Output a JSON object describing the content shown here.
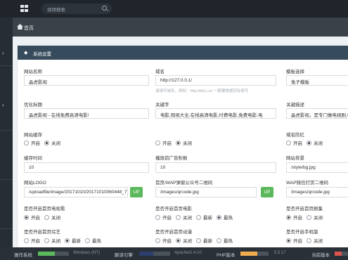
{
  "topbar": {
    "search_placeholder": "视频搜索"
  },
  "breadcrumb": {
    "home_label": "首页"
  },
  "panel": {
    "title": "系统设置"
  },
  "fields": {
    "site_name": {
      "label": "网站名称",
      "value": "晶虎影视"
    },
    "domain": {
      "label": "域名",
      "value": "http://127.0.0.1/",
      "hint": "请填写域名，例如：http://bb1.cn/ 一般要根据实际填写"
    },
    "template": {
      "label": "模板选择",
      "value": "免子模板"
    },
    "seo_title": {
      "label": "优化标题",
      "value": "晶虎影视 - 在线免费高清电影!"
    },
    "keywords": {
      "label": "关键字",
      "value": "电影,观视大全,在线高清电影,付费电影,免费电影,电"
    },
    "description": {
      "label": "关键描述",
      "value": "晶虎影视，是专门做电视剧,电"
    },
    "cache": {
      "label": "网站缓存",
      "options": [
        "开启",
        "关闭"
      ],
      "selected": 1
    },
    "domain_redirect": {
      "label": "域名防红",
      "options": [
        "开启",
        "关闭"
      ],
      "selected": 1
    },
    "cache_time": {
      "label": "缓存时间",
      "value": "10"
    },
    "ad_seconds": {
      "label": "播放前广告秒数",
      "value": "10"
    },
    "background": {
      "label": "网站背景",
      "value": "/style/bg.jpg"
    },
    "logo": {
      "label": "网站LOGO",
      "value": "/uploadfile/image/20171010/20171010060448_7",
      "button": "UP"
    },
    "wap_qr": {
      "label": "首页/WAP弹窗公众号二维码",
      "value": "/images/qrcode.jpg",
      "button": "UP"
    },
    "wap_mini_qr": {
      "label": "WAP微信打赏二维码",
      "value": "/images/qrcode.jpg"
    },
    "home_tv": {
      "label": "是否开启首页电视看",
      "options": [
        "开启",
        "关闭"
      ],
      "selected": 0
    },
    "home_movie": {
      "label": "是否开启首页电影",
      "options": [
        "开启",
        "关闭",
        "最新",
        "最热"
      ],
      "selected": 3
    },
    "home_series": {
      "label": "是否开启首页剧集",
      "options": [
        "开启",
        "关闭"
      ],
      "selected": 0
    },
    "home_variety": {
      "label": "是否开启首页综艺",
      "options": [
        "开启",
        "关闭",
        "最新",
        "最热"
      ],
      "selected": 2
    },
    "home_anime": {
      "label": "是否开启首页动漫",
      "options": [
        "开启",
        "关闭",
        "最新",
        "最热"
      ],
      "selected": 1
    },
    "mobile_version": {
      "label": "是否开启手机版",
      "options": [
        "开启",
        "关闭"
      ],
      "selected": 0
    }
  },
  "status_bar": {
    "os": {
      "label": "操作系统",
      "value": "Windows (NT)",
      "fill": 0.55,
      "color": "#5cb85c"
    },
    "server": {
      "label": "解译引擎",
      "value": "Apache/2.4.10",
      "fill": 0.45,
      "color": "#2d3e6e"
    },
    "php": {
      "label": "PHP版本",
      "value": "5.5.17",
      "fill": 0.6,
      "color": "#f0ad4e"
    },
    "current": {
      "label": "当前版本",
      "fill": 0.5,
      "color": "#d9534f"
    }
  }
}
